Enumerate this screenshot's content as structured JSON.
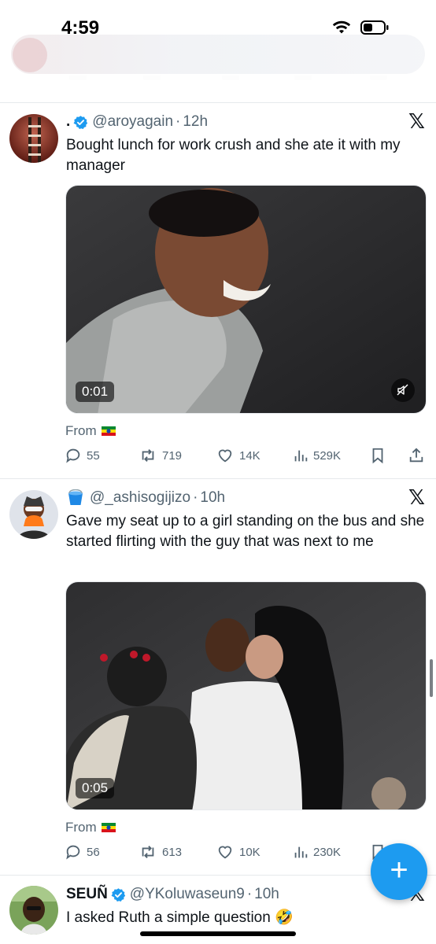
{
  "status": {
    "time": "4:59"
  },
  "tweets": [
    {
      "display_name": ".",
      "handle": "@aroyagain",
      "time": "12h",
      "text": "Bought lunch for work crush and she ate it with my manager",
      "duration": "0:01",
      "from_label": "From",
      "replies": "55",
      "retweets": "719",
      "likes": "14K",
      "views": "529K"
    },
    {
      "display_name": "",
      "handle": "@_ashisogijizo",
      "time": "10h",
      "text": "Gave my seat up to a girl standing on the bus and she started flirting with the guy that was next to me",
      "duration": "0:05",
      "from_label": "From",
      "replies": "56",
      "retweets": "613",
      "likes": "10K",
      "views": "230K"
    },
    {
      "display_name": "SEUÑ",
      "handle": "@YKoluwaseun9",
      "time": "10h",
      "text": "I asked Ruth a simple question 🤣"
    }
  ],
  "fab": {
    "label": "+"
  },
  "colors": {
    "accent": "#1d9bf0",
    "text": "#0f1419",
    "muted": "#536471"
  }
}
